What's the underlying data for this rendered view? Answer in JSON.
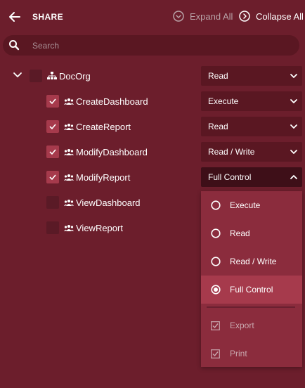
{
  "header": {
    "title": "SHARE",
    "expand_all": "Expand All",
    "collapse_all": "Collapse All"
  },
  "search": {
    "placeholder": "Search",
    "value": ""
  },
  "tree": {
    "root": {
      "label": "DocOrg",
      "checked": false,
      "permission": "Read",
      "icon": "org-chart-icon"
    },
    "children": [
      {
        "label": "CreateDashboard",
        "checked": true,
        "permission": "Execute",
        "icon": "group-icon"
      },
      {
        "label": "CreateReport",
        "checked": true,
        "permission": "Read",
        "icon": "group-icon"
      },
      {
        "label": "ModifyDashboard",
        "checked": true,
        "permission": "Read / Write",
        "icon": "group-icon"
      },
      {
        "label": "ModifyReport",
        "checked": true,
        "permission": "Full Control",
        "icon": "group-icon"
      },
      {
        "label": "ViewDashboard",
        "checked": false,
        "icon": "group-icon"
      },
      {
        "label": "ViewReport",
        "checked": false,
        "icon": "group-icon"
      }
    ]
  },
  "permission_menu": {
    "options": [
      {
        "label": "Execute",
        "selected": false
      },
      {
        "label": "Read",
        "selected": false
      },
      {
        "label": "Read / Write",
        "selected": false
      },
      {
        "label": "Full Control",
        "selected": true
      }
    ],
    "extras": [
      {
        "label": "Export",
        "checked": true,
        "enabled": false
      },
      {
        "label": "Print",
        "checked": true,
        "enabled": false
      }
    ]
  },
  "colors": {
    "background": "#6c1e2c",
    "field": "#5a1722",
    "accent": "#a63a4c",
    "menu": "#8b2c3d"
  }
}
